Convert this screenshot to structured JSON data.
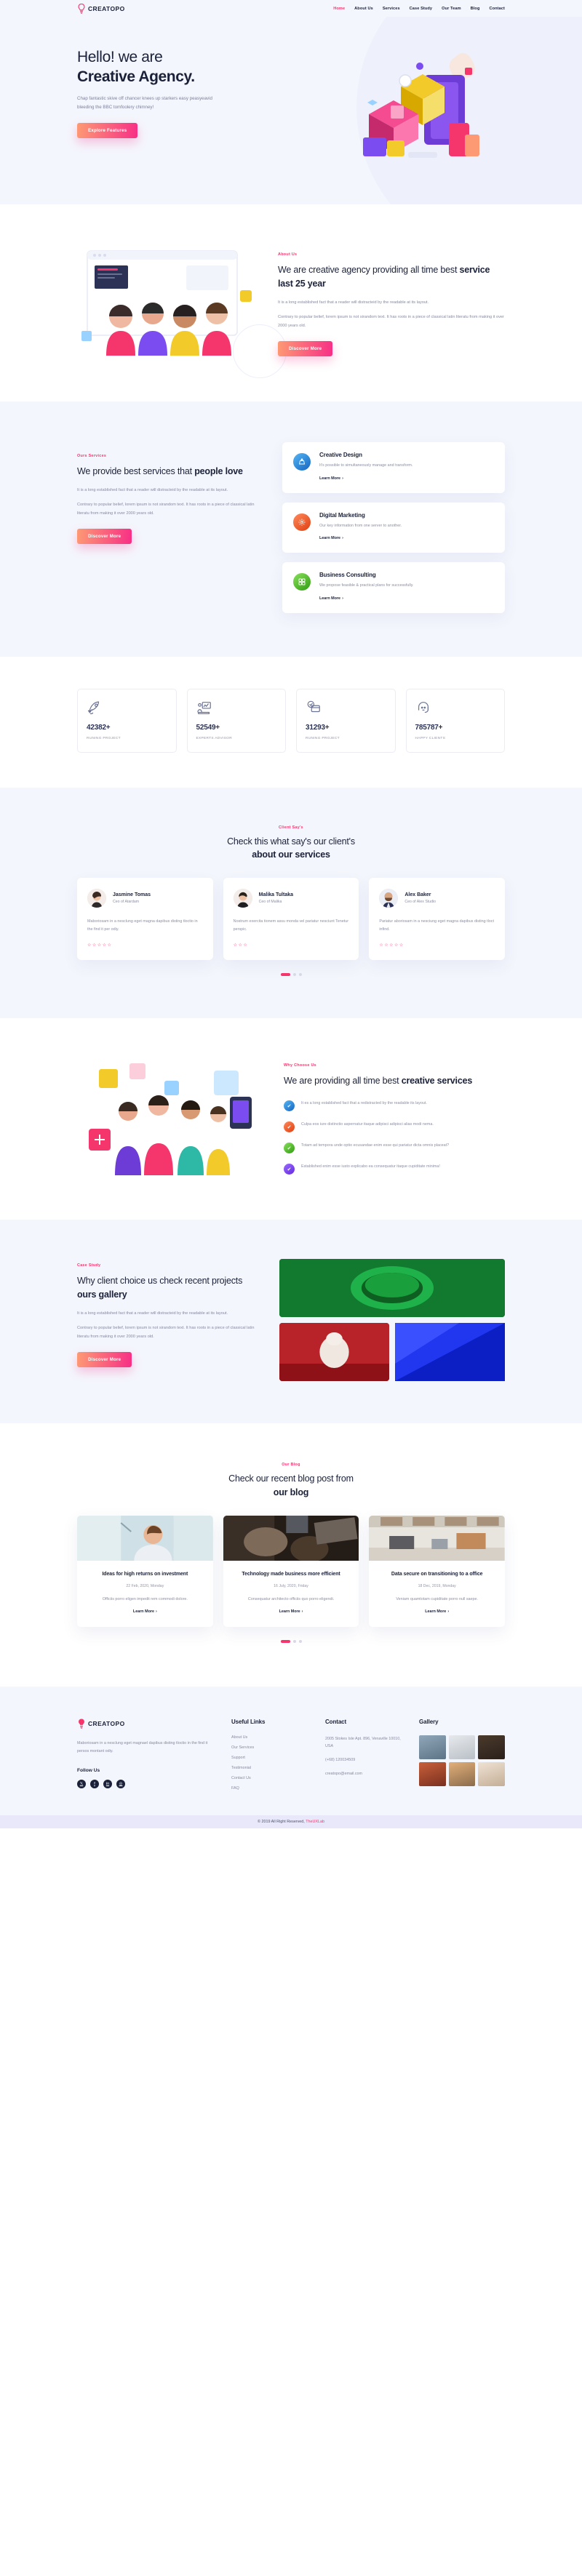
{
  "brand": {
    "name": "CREATOPO",
    "icon": "bulb-icon",
    "accent": "#f5366c"
  },
  "nav": {
    "items": [
      {
        "label": "Home",
        "active": true
      },
      {
        "label": "About Us",
        "active": false
      },
      {
        "label": "Services",
        "active": false
      },
      {
        "label": "Case Study",
        "active": false
      },
      {
        "label": "Our Team",
        "active": false
      },
      {
        "label": "Blog",
        "active": false
      },
      {
        "label": "Contact",
        "active": false
      }
    ]
  },
  "hero": {
    "line1": "Hello! we are",
    "line2": "Creative Agency.",
    "paragraph": "Chap fantastic skive off chancer knees up starkers easy peasyeavid bleeding the BBC tomfoolery chimney!",
    "cta": "Explore Features"
  },
  "about": {
    "eyebrow": "About Us",
    "title_light": "We are creative agency providing all time best",
    "title_bold": "service last 25 year",
    "p1": "It is a long established fact that a reader will distracteid by the readable at its layout.",
    "p2": "Contrary to popular belief, lorem ipsum is not sirandom text. It has roots in a piece of classical latin literatu from making it over 2000 years old.",
    "cta": "Discover More"
  },
  "services": {
    "eyebrow": "Ours Services",
    "title_light": "We provide best services that ",
    "title_bold": "people love",
    "p1": "It is a long established fact that a reader will distracteid by the readable at its layout.",
    "p2": "Contrary to popular belief, lorem ipsum is not sirandom text. It has roots in a piece of classical latin literatu from making it over 2000 years old.",
    "cta": "Discover More",
    "cards": [
      {
        "title": "Creative Design",
        "desc": "It's possible to simultaneously manage and transform.",
        "link": "Learn More",
        "icon": "design-icon",
        "color": "#2196f3",
        "color2": "#1565c0"
      },
      {
        "title": "Digital Marketing",
        "desc": "Our key information from one server to another.",
        "link": "Learn More",
        "icon": "marketing-icon",
        "color": "#f4623a",
        "color2": "#e03e10"
      },
      {
        "title": "Business Consulting",
        "desc": "We propose feasible & practical plans for successfully.",
        "link": "Learn More",
        "icon": "consulting-icon",
        "color": "#5bc236",
        "color2": "#2f9c10"
      }
    ]
  },
  "counters": {
    "items": [
      {
        "value": "42382+",
        "label": "RUNING PROJECT",
        "icon": "rocket-icon"
      },
      {
        "value": "52549+",
        "label": "EXPERTS ADVISOR",
        "icon": "presentation-icon"
      },
      {
        "value": "31293+",
        "label": "RUNING PROJECT",
        "icon": "payment-icon"
      },
      {
        "value": "785787+",
        "label": "HAPPY CLIENTS",
        "icon": "support-agent-icon"
      }
    ]
  },
  "testimonials": {
    "eyebrow": "Client Say's",
    "title_light": "Check this what say's our client's",
    "title_bold": "about our services",
    "cards": [
      {
        "name": "Jasmine Tomas",
        "role": "Ceo of Atardam",
        "text": "Maboriosam in a nesclung eget magna dapibus disting tloctio in the find it per odiy.",
        "stars": 5
      },
      {
        "name": "Malika Tultaka",
        "role": "Ceo of Malika",
        "text": "Nostrum exercita tionem assu monda vel pariatur nesciunt Tenetur perspic.",
        "stars": 3
      },
      {
        "name": "Alex Baker",
        "role": "Ceo of Alex Studio",
        "text": "Pariatur aboriosam in a nesciung eget magna dapibus disting tloct infind.",
        "stars": 5
      }
    ]
  },
  "why": {
    "eyebrow": "Why Choose Us",
    "title_light": "We are providing all time best ",
    "title_bold": "creative services",
    "features": [
      {
        "text": "It es a long established fact that a redistracted by the readable its layout.",
        "color": "#2196f3"
      },
      {
        "text": "Culpa eos iure distinctio aspernatur itaque adipisci adipisci alias modi nema.",
        "color": "#f4623a"
      },
      {
        "text": "Totam ad tempora unde optio ecusandae enim esse qui pariatur dicta omnis placeat?",
        "color": "#5bc236"
      },
      {
        "text": "Established enim esse iusto explicabo ea consequatur itaque cupiditate minima!",
        "color": "#7b4df0"
      }
    ]
  },
  "casestudy": {
    "eyebrow": "Case Study",
    "title_light": "Why client choice us check recent projects",
    "title_bold": "ours gallery",
    "p1": "It is a long established fact that a reader will distracteid by the readable at its layout.",
    "p2": "Contrary to popular belief, lorem ipsum is not sirandom text. It has roots in a piece of classical latin literatu from making it over 2000 years old.",
    "cta": "Discover More"
  },
  "blog": {
    "eyebrow": "Our Blog",
    "title_light": "Check our recent blog post from",
    "title_bold": "our blog",
    "posts": [
      {
        "title": "Ideas for high returns on investment",
        "date": "22 Feb, 2020, Monday",
        "desc": "Officiis porro eligen impedit rem commodi dolore.",
        "link": "Learn More"
      },
      {
        "title": "Technology made business more efficient",
        "date": "16 July, 2020, Friday",
        "desc": "Consequatur architecto officiis quo porro eligendi.",
        "link": "Learn More"
      },
      {
        "title": "Data secure on transitioning to a office",
        "date": "18 Dec, 2019, Monday",
        "desc": "Veniam quamtotam cupiditate porro null saepe.",
        "link": "Learn More"
      }
    ]
  },
  "footer": {
    "brand": "CREATOPO",
    "about": "Maboriosam in a nesclung eget magnael dapibus disting tloctio in the find it persos montant odiy.",
    "follow_title": "Follow Us",
    "socials": [
      "twitter-icon",
      "facebook-icon",
      "linkedin-icon",
      "instagram-icon"
    ],
    "links_title": "Useful Links",
    "links": [
      "About Us",
      "Our Services",
      "Support",
      "Testimonial",
      "Contact Us",
      "FAQ"
    ],
    "contact_title": "Contact",
    "address": "2005 Stokes Isle Apt. 896, Venaville 10010, USA",
    "phone": "(+68) 120034509",
    "email": "creatopo@email.com",
    "gallery_title": "Gallery"
  },
  "copyright": {
    "text": "© 2019 All Right Reserved, ",
    "brand": "TheUXLab"
  }
}
